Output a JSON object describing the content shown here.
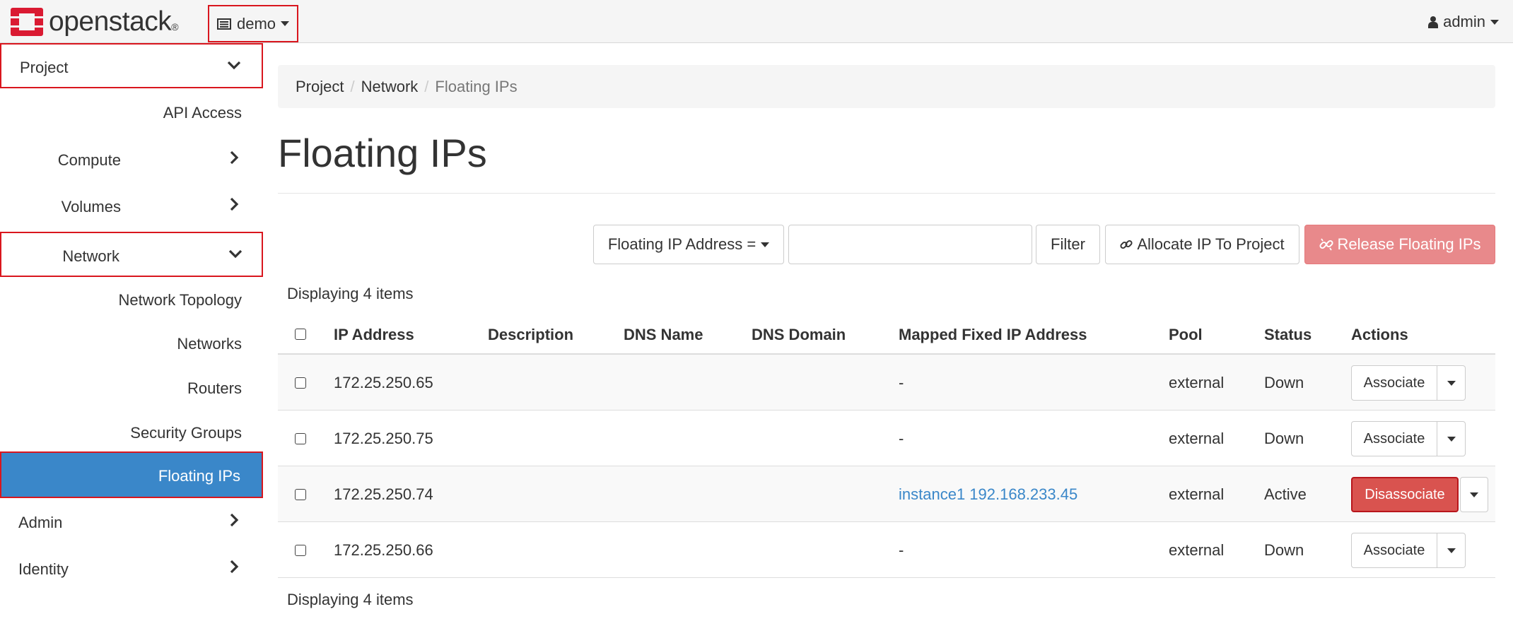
{
  "navbar": {
    "brand": "openstack",
    "brand_mark": "®",
    "project": "demo",
    "user": "admin"
  },
  "sidebar": {
    "project": "Project",
    "api_access": "API Access",
    "compute": "Compute",
    "volumes": "Volumes",
    "network": "Network",
    "network_topology": "Network Topology",
    "networks": "Networks",
    "routers": "Routers",
    "security_groups": "Security Groups",
    "floating_ips": "Floating IPs",
    "admin": "Admin",
    "identity": "Identity"
  },
  "breadcrumb": {
    "project": "Project",
    "network": "Network",
    "current": "Floating IPs",
    "separator": "/"
  },
  "page": {
    "title": "Floating IPs"
  },
  "toolbar": {
    "filter_field": "Floating IP Address =",
    "filter_value": "",
    "filter_button": "Filter",
    "allocate_button": "Allocate IP To Project",
    "release_button": "Release Floating IPs"
  },
  "table": {
    "count_label": "Displaying 4 items",
    "columns": [
      "IP Address",
      "Description",
      "DNS Name",
      "DNS Domain",
      "Mapped Fixed IP Address",
      "Pool",
      "Status",
      "Actions"
    ],
    "rows": [
      {
        "ip": "172.25.250.65",
        "description": "",
        "dns_name": "",
        "dns_domain": "",
        "mapped": "-",
        "pool": "external",
        "status": "Down",
        "action": "Associate"
      },
      {
        "ip": "172.25.250.75",
        "description": "",
        "dns_name": "",
        "dns_domain": "",
        "mapped": "-",
        "pool": "external",
        "status": "Down",
        "action": "Associate"
      },
      {
        "ip": "172.25.250.74",
        "description": "",
        "dns_name": "",
        "dns_domain": "",
        "mapped": "instance1 192.168.233.45",
        "pool": "external",
        "status": "Active",
        "action": "Disassociate"
      },
      {
        "ip": "172.25.250.66",
        "description": "",
        "dns_name": "",
        "dns_domain": "",
        "mapped": "-",
        "pool": "external",
        "status": "Down",
        "action": "Associate"
      }
    ]
  },
  "colors": {
    "accent": "#3a87c9",
    "highlight_border": "#d9161e",
    "danger": "#d9534f",
    "release_disabled": "#e8898b",
    "logo_red": "#da1a32"
  },
  "icons": {
    "logo": "openstack-logo-icon",
    "project": "project-list-icon",
    "user": "user-icon",
    "chevron_down": "chevron-down-icon",
    "chevron_right": "chevron-right-icon",
    "link": "link-icon",
    "unlink": "unlink-icon",
    "caret": "caret-down-icon"
  }
}
